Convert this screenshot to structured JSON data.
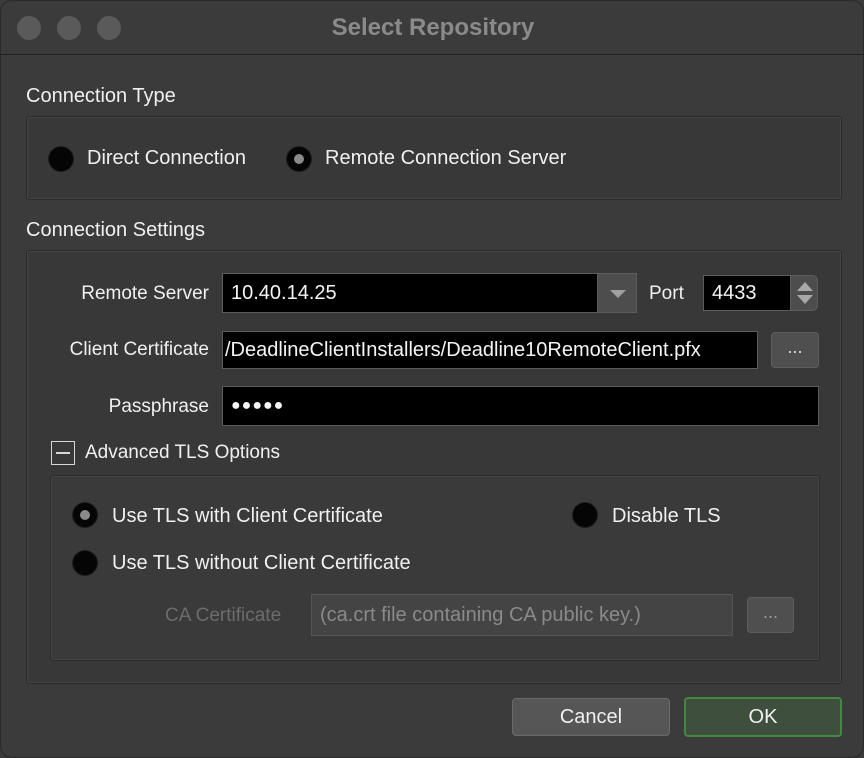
{
  "window": {
    "title": "Select Repository"
  },
  "connection_type": {
    "label": "Connection Type",
    "options": [
      {
        "label": "Direct Connection",
        "checked": false
      },
      {
        "label": "Remote Connection Server",
        "checked": true
      }
    ]
  },
  "connection_settings": {
    "label": "Connection Settings",
    "remote_server": {
      "label": "Remote Server",
      "value": "10.40.14.25"
    },
    "port": {
      "label": "Port",
      "value": "4433"
    },
    "client_certificate": {
      "label": "Client Certificate",
      "value": "/DeadlineClientInstallers/Deadline10RemoteClient.pfx",
      "browse_label": "..."
    },
    "passphrase": {
      "label": "Passphrase",
      "value": "●●●●●"
    }
  },
  "advanced_tls": {
    "label": "Advanced TLS Options",
    "options": [
      {
        "label": "Use TLS with Client Certificate",
        "checked": true
      },
      {
        "label": "Disable TLS",
        "checked": false
      },
      {
        "label": "Use TLS without Client Certificate",
        "checked": false
      }
    ],
    "ca_certificate": {
      "label": "CA Certificate",
      "placeholder": "(ca.crt file containing CA public key.)",
      "browse_label": "..."
    }
  },
  "buttons": {
    "cancel": "Cancel",
    "ok": "OK"
  },
  "colors": {
    "ok_border": "#3f8a3e",
    "background": "#3b3b3b"
  }
}
